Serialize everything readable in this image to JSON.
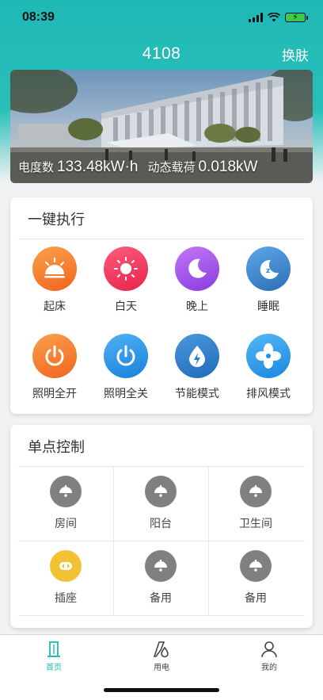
{
  "status_bar": {
    "time": "08:39"
  },
  "nav": {
    "title": "4108",
    "action": "换肤"
  },
  "banner": {
    "energy_label": "电度数",
    "energy_value": "133.48kW·h",
    "load_label": "动态载荷",
    "load_value": "0.018kW"
  },
  "quick_actions": {
    "title": "一键执行",
    "items": [
      {
        "label": "起床",
        "icon": "sunrise-icon",
        "color": "#f36f2b"
      },
      {
        "label": "白天",
        "icon": "sun-icon",
        "color": "#ee2f58"
      },
      {
        "label": "晚上",
        "icon": "moon-icon",
        "color": "#9b4ce8"
      },
      {
        "label": "睡眠",
        "icon": "sleep-icon",
        "color": "#3a86cc"
      },
      {
        "label": "照明全开",
        "icon": "power-on-icon",
        "color": "#f36f2b"
      },
      {
        "label": "照明全关",
        "icon": "power-off-icon",
        "color": "#1e8fe0"
      },
      {
        "label": "节能模式",
        "icon": "energy-saving-icon",
        "color": "#2a7fd0"
      },
      {
        "label": "排风模式",
        "icon": "fan-icon",
        "color": "#1e90e6"
      }
    ]
  },
  "single_control": {
    "title": "单点控制",
    "items": [
      {
        "label": "房间",
        "icon": "bulb-icon",
        "color": "#808080"
      },
      {
        "label": "阳台",
        "icon": "bulb-icon",
        "color": "#808080"
      },
      {
        "label": "卫生间",
        "icon": "bulb-icon",
        "color": "#808080"
      },
      {
        "label": "插座",
        "icon": "socket-icon",
        "color": "#f2c232"
      },
      {
        "label": "备用",
        "icon": "bulb-icon",
        "color": "#808080"
      },
      {
        "label": "备用",
        "icon": "bulb-icon",
        "color": "#808080"
      }
    ]
  },
  "tabbar": {
    "items": [
      {
        "label": "首页",
        "icon": "building-icon",
        "active": true
      },
      {
        "label": "用电",
        "icon": "electricity-icon",
        "active": false
      },
      {
        "label": "我的",
        "icon": "person-icon",
        "active": false
      }
    ],
    "accent": "#1fb9b5"
  }
}
